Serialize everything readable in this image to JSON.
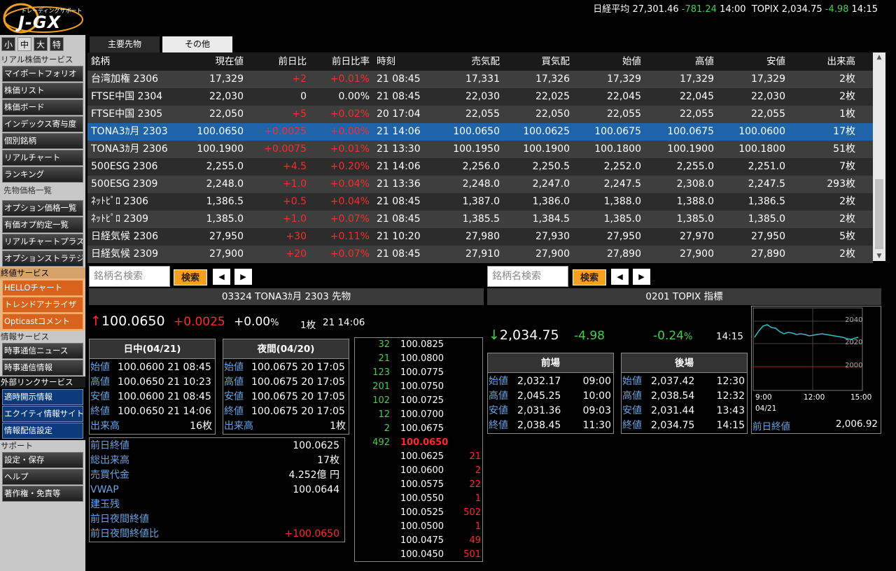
{
  "app": {
    "logo_small": "トレーディングサポート",
    "logo_big": "J-GX"
  },
  "ticker": {
    "nikkei_label": "日経平均",
    "nikkei_value": "27,301.46",
    "nikkei_change": "-781.24",
    "nikkei_time": "14:00",
    "topix_label": "TOPIX",
    "topix_value": "2,034.75",
    "topix_change": "-4.98",
    "topix_time": "14:15"
  },
  "sidebar": {
    "sizes": [
      "小",
      "中",
      "大",
      "特"
    ],
    "sections": {
      "real": "リアル株価サービス",
      "fut": "先物価格一覧",
      "final": "終値サービス",
      "info": "情報サービス",
      "ext": "外部リンクサービス",
      "support": "サポート"
    },
    "real_items": [
      "マイポートフォリオ",
      "株価リスト",
      "株価ボード",
      "インデックス寄与度",
      "個別銘柄",
      "リアルチャート",
      "ランキング"
    ],
    "fut_items": [
      "オプション価格一覧",
      "有価オプ約定一覧",
      "リアルチャートプラス",
      "オプションストラテジ"
    ],
    "final_items": [
      "HELLOチャート",
      "トレンドアナライザ",
      "Opticastコメント"
    ],
    "info_items": [
      "時事通信ニュース",
      "時事通信情報"
    ],
    "ext_items": [
      "適時開示情報",
      "エクイティ情報サイト",
      "情報配信設定"
    ],
    "support_items": [
      "設定・保存",
      "ヘルプ",
      "著作権・免責等"
    ]
  },
  "tabs": [
    "主要先物",
    "その他"
  ],
  "grid": {
    "headers": [
      "銘柄",
      "現在値",
      "前日比",
      "前日比率",
      "時刻",
      "売気配",
      "買気配",
      "始値",
      "高値",
      "安値",
      "出来高"
    ],
    "rows": [
      [
        "台湾加権 2306",
        "17,329",
        "+2",
        "+0.01%",
        "21 08:45",
        "17,331",
        "17,326",
        "17,329",
        "17,329",
        "17,329",
        "2枚"
      ],
      [
        "FTSE中国 2304",
        "22,030",
        "0",
        "0.00%",
        "21 08:45",
        "22,030",
        "22,025",
        "22,045",
        "22,045",
        "22,030",
        "2枚"
      ],
      [
        "FTSE中国 2305",
        "22,050",
        "+5",
        "+0.02%",
        "20 17:04",
        "22,055",
        "22,050",
        "22,055",
        "22,055",
        "22,055",
        "1枚"
      ],
      [
        "TONA3ｶ月 2303",
        "100.0650",
        "+0.0025",
        "+0.00%",
        "21 14:06",
        "100.0650",
        "100.0625",
        "100.0675",
        "100.0675",
        "100.0600",
        "17枚"
      ],
      [
        "TONA3ｶ月 2306",
        "100.1900",
        "+0.0075",
        "+0.01%",
        "21 13:30",
        "100.1950",
        "100.1900",
        "100.1800",
        "100.1900",
        "100.1800",
        "51枚"
      ],
      [
        "500ESG 2306",
        "2,255.0",
        "+4.5",
        "+0.20%",
        "21 14:06",
        "2,256.0",
        "2,250.5",
        "2,252.0",
        "2,255.0",
        "2,251.0",
        "7枚"
      ],
      [
        "500ESG 2309",
        "2,248.0",
        "+1.0",
        "+0.04%",
        "21 13:36",
        "2,248.0",
        "2,247.0",
        "2,247.5",
        "2,308.0",
        "2,247.5",
        "293枚"
      ],
      [
        "ﾈｯﾄﾋﾟﾛ 2306",
        "1,386.5",
        "+0.5",
        "+0.04%",
        "21 08:45",
        "1,387.0",
        "1,386.0",
        "1,388.0",
        "1,388.0",
        "1,386.5",
        "2枚"
      ],
      [
        "ﾈｯﾄﾋﾟﾛ 2309",
        "1,385.0",
        "+1.0",
        "+0.07%",
        "21 08:45",
        "1,385.5",
        "1,384.5",
        "1,385.0",
        "1,385.0",
        "1,385.0",
        "2枚"
      ],
      [
        "日経気候 2306",
        "27,950",
        "+30",
        "+0.11%",
        "21 10:20",
        "27,980",
        "27,930",
        "27,950",
        "27,970",
        "27,950",
        "5枚"
      ],
      [
        "日経気候 2309",
        "27,900",
        "+20",
        "+0.07%",
        "21 08:45",
        "27,910",
        "27,900",
        "27,890",
        "27,900",
        "27,890",
        "2枚"
      ]
    ]
  },
  "left_panel": {
    "search_placeholder": "銘柄名検索",
    "search_btn": "検索",
    "prev": "◀",
    "next": "▶",
    "title": "03324 TONA3ｶ月 2303 先物",
    "arrow": "↑",
    "price": "100.0650",
    "change": "+0.0025",
    "pct": "+0.00",
    "pct_unit": "%",
    "volume": "1枚",
    "time": "21 14:06",
    "day": {
      "title": "日中(04/21)",
      "rows": [
        [
          "始値",
          "100.0600 21 08:45"
        ],
        [
          "高値",
          "100.0650 21 10:23"
        ],
        [
          "安値",
          "100.0600 21 08:45"
        ],
        [
          "終値",
          "100.0650 21 14:06"
        ]
      ],
      "vol_label": "出来高",
      "vol": "16枚"
    },
    "night": {
      "title": "夜間(04/20)",
      "rows": [
        [
          "始値",
          "100.0675 20 17:05"
        ],
        [
          "高値",
          "100.0675 20 17:05"
        ],
        [
          "安値",
          "100.0675 20 17:05"
        ],
        [
          "終値",
          "100.0675 20 17:05"
        ]
      ],
      "vol_label": "出来高",
      "vol": "1枚"
    },
    "stats": [
      [
        "前日終値",
        "100.0625"
      ],
      [
        "総出来高",
        "17枚"
      ],
      [
        "売買代金",
        "4.252億 円"
      ],
      [
        "VWAP",
        "100.0644"
      ],
      [
        "建玉残",
        ""
      ],
      [
        "前日夜間終値",
        ""
      ],
      [
        "前日夜間終値比",
        "+100.0650"
      ]
    ],
    "orderbook": [
      [
        "32",
        "100.0825",
        ""
      ],
      [
        "21",
        "100.0800",
        ""
      ],
      [
        "123",
        "100.0775",
        ""
      ],
      [
        "201",
        "100.0750",
        ""
      ],
      [
        "102",
        "100.0725",
        ""
      ],
      [
        "12",
        "100.0700",
        ""
      ],
      [
        "2",
        "100.0675",
        ""
      ],
      [
        "492",
        "100.0650",
        ""
      ],
      [
        "",
        "100.0625",
        "21"
      ],
      [
        "",
        "100.0600",
        "2"
      ],
      [
        "",
        "100.0575",
        "22"
      ],
      [
        "",
        "100.0550",
        "1"
      ],
      [
        "",
        "100.0525",
        "502"
      ],
      [
        "",
        "100.0500",
        "1"
      ],
      [
        "",
        "100.0475",
        "49"
      ],
      [
        "",
        "100.0450",
        "501"
      ]
    ]
  },
  "right_panel": {
    "search_placeholder": "銘柄名検索",
    "search_btn": "検索",
    "prev": "◀",
    "next": "▶",
    "title": "0201 TOPIX 指標",
    "arrow": "↓",
    "price": "2,034.75",
    "change": "-4.98",
    "pct": "-0.24",
    "pct_unit": "%",
    "time": "14:15",
    "am": {
      "title": "前場",
      "rows": [
        [
          "始値",
          "2,032.17",
          "09:00"
        ],
        [
          "高値",
          "2,045.25",
          "10:00"
        ],
        [
          "安値",
          "2,031.36",
          "09:03"
        ],
        [
          "終値",
          "2,038.45",
          "11:30"
        ]
      ]
    },
    "pm": {
      "title": "後場",
      "rows": [
        [
          "始値",
          "2,037.42",
          "12:30"
        ],
        [
          "高値",
          "2,038.54",
          "12:32"
        ],
        [
          "安値",
          "2,031.44",
          "13:43"
        ],
        [
          "終値",
          "2,034.75",
          "14:15"
        ]
      ]
    },
    "chart": {
      "y_ticks": [
        "2040",
        "2020",
        "2000"
      ],
      "x_ticks": [
        "9:00",
        "12:00",
        "15:00"
      ],
      "date": "04/21"
    },
    "prev_close_label": "前日終値",
    "prev_close": "2,006.92"
  },
  "colors": {
    "positive": "#3fd04f",
    "negative": "#ff2a2a",
    "accent": "#f7a020",
    "selected_row": "#1f64a8"
  }
}
